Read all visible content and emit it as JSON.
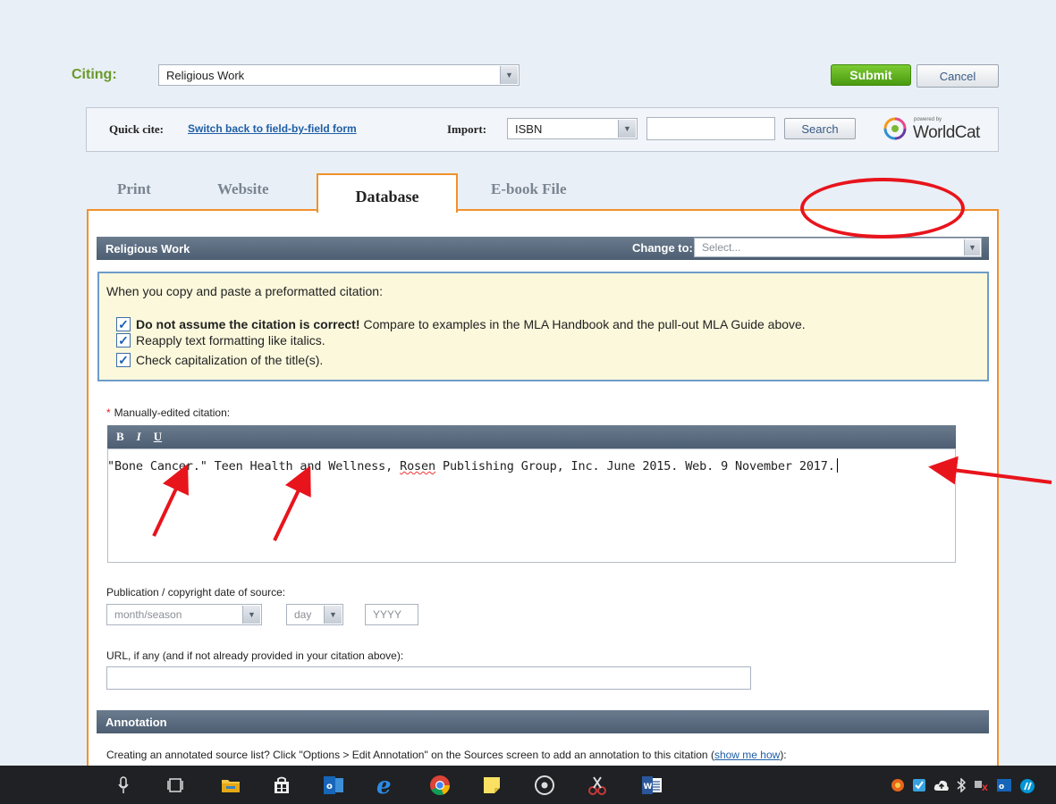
{
  "citing": {
    "label": "Citing:",
    "selected": "Religious Work",
    "submit_label": "Submit",
    "cancel_label": "Cancel"
  },
  "quick_cite": {
    "label": "Quick cite:",
    "link": "Switch back to field-by-field form",
    "import_label": "Import:",
    "import_selected": "ISBN",
    "search_label": "Search",
    "worldcat_powered": "powered by",
    "worldcat_brand": "WorldCat"
  },
  "tabs": [
    {
      "label": "Print"
    },
    {
      "label": "Website"
    },
    {
      "label": "Database"
    },
    {
      "label": "E-book File"
    }
  ],
  "form": {
    "section_title": "Religious Work",
    "change_to_label": "Change to:",
    "change_to_placeholder": "Select...",
    "notice": {
      "intro": "When you copy and paste a preformatted citation:",
      "item1_bold": "Do not assume the citation is correct!",
      "item1_rest": "Compare to examples in the MLA Handbook and the pull-out MLA Guide above.",
      "item2": "Reapply text formatting like italics.",
      "item3": "Check capitalization of the title(s)."
    },
    "manual_required": "*",
    "manual_label": "Manually-edited citation:",
    "toolbar": {
      "bold": "B",
      "italic": "I",
      "underline": "U"
    },
    "citation_before": "\"Bone Cancer.\" Teen Health and Wellness, ",
    "citation_flagged": "Rosen",
    "citation_after": " Publishing Group, Inc. June 2015. Web. 9 November 2017.",
    "pubdate_label": "Publication / copyright date of source:",
    "month_placeholder": "month/season",
    "day_placeholder": "day",
    "year_placeholder": "YYYY",
    "url_label": "URL, if any (and if not already provided in your citation above):",
    "annotation_title": "Annotation",
    "annotation_text": "Creating an annotated source list? Click \"Options > Edit Annotation\" on the Sources screen to add an annotation to this citation (",
    "annotation_link": "show me how",
    "annotation_end": "):"
  },
  "colors": {
    "accent_orange": "#f0922b",
    "submit_green": "#5aad1a",
    "annotation_red": "#e8141c"
  },
  "taskbar_icons": [
    "microphone-icon",
    "task-view-icon",
    "file-explorer-icon",
    "store-icon",
    "outlook-icon",
    "edge-icon",
    "chrome-icon",
    "sticky-notes-icon",
    "cortana-icon",
    "snipping-tool-icon",
    "word-icon"
  ]
}
